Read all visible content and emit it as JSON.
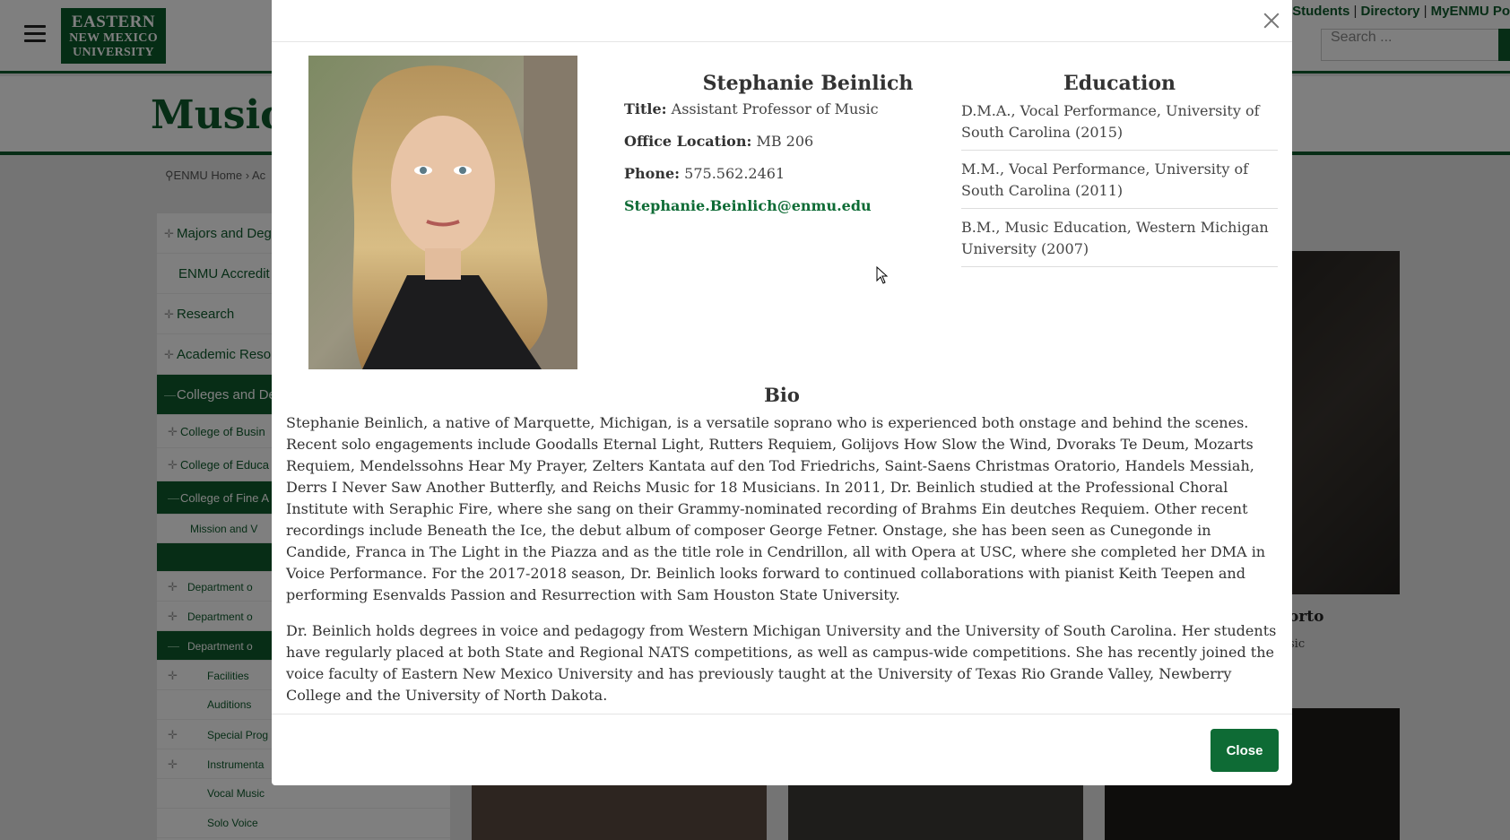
{
  "header": {
    "logo_lines": [
      "EASTERN",
      "NEW MEXICO",
      "UNIVERSITY"
    ],
    "top_links": [
      "t Students",
      "Directory",
      "MyENMU Po"
    ],
    "search_placeholder": "Search ..."
  },
  "page": {
    "title": "Music",
    "breadcrumb": [
      "ENMU Home",
      "Ac"
    ]
  },
  "sidebar": {
    "items": [
      {
        "label": "Majors and Degr",
        "expandable": true,
        "level": 1
      },
      {
        "label": "ENMU Accredit",
        "expandable": false,
        "level": 1
      },
      {
        "label": "Research",
        "expandable": true,
        "level": 1
      },
      {
        "label": "Academic Resou",
        "expandable": true,
        "level": 1
      },
      {
        "label": "Colleges and De",
        "expandable": true,
        "level": 1,
        "active": true
      },
      {
        "label": "College of Busin",
        "expandable": true,
        "level": 2
      },
      {
        "label": "College of Educa",
        "expandable": true,
        "level": 2
      },
      {
        "label": "College of Fine A",
        "expandable": true,
        "level": 2,
        "active": true
      },
      {
        "label": "Mission and V",
        "expandable": false,
        "level": 3
      },
      {
        "label": "",
        "expandable": false,
        "level": 3,
        "active": true
      },
      {
        "label": "Department o",
        "expandable": true,
        "level": 4
      },
      {
        "label": "Department o",
        "expandable": true,
        "level": 4
      },
      {
        "label": "Department o",
        "expandable": true,
        "level": 4,
        "active": true
      },
      {
        "label": "Facilities",
        "expandable": true,
        "level": 5
      },
      {
        "label": "Auditions",
        "expandable": false,
        "level": 5
      },
      {
        "label": "Special Prog",
        "expandable": true,
        "level": 5
      },
      {
        "label": "Instrumenta",
        "expandable": true,
        "level": 5
      },
      {
        "label": "Vocal Music",
        "expandable": false,
        "level": 5
      },
      {
        "label": "Solo Voice",
        "expandable": false,
        "level": 5
      }
    ]
  },
  "background_card": {
    "name_fragment": "orto",
    "title_fragment": "sic"
  },
  "modal": {
    "name": "Stephanie Beinlich",
    "title_label": "Title:",
    "title_value": "Assistant Professor of Music",
    "office_label": "Office Location:",
    "office_value": "MB 206",
    "phone_label": "Phone:",
    "phone_value": "575.562.2461",
    "email": "Stephanie.Beinlich@enmu.edu",
    "education_heading": "Education",
    "education": [
      "D.M.A., Vocal Performance, University of South Carolina (2015)",
      "M.M., Vocal Performance, University of South Carolina (2011)",
      "B.M., Music Education, Western Michigan University (2007)"
    ],
    "bio_heading": "Bio",
    "bio_paragraphs": [
      "Stephanie Beinlich, a native of Marquette, Michigan, is a versatile soprano who is experienced both onstage and behind the scenes. Recent solo engagements include Goodalls Eternal Light, Rutters Requiem, Golijovs How Slow the Wind, Dvoraks Te Deum, Mozarts Requiem, Mendelssohns Hear My Prayer, Zelters Kantata auf den Tod Friedrichs, Saint-Saens Christmas Oratorio, Handels Messiah, Derrs I Never Saw Another Butterfly, and Reichs Music for 18 Musicians. In 2011, Dr. Beinlich studied at the Professional Choral Institute with Seraphic Fire, where she sang on their Grammy-nominated recording of Brahms Ein deutches Requiem. Other recent recordings include Beneath the Ice, the debut album of composer George Fetner. Onstage, she has been seen as Cunegonde in Candide, Franca in The Light in the Piazza and as the title role in Cendrillon, all with Opera at USC, where she completed her DMA in Voice Performance. For the 2017-2018 season, Dr. Beinlich looks forward to continued collaborations with pianist Keith Teepen and performing Esenvalds Passion and Resurrection with Sam Houston State University.",
      "Dr. Beinlich holds degrees in voice and pedagogy from Western Michigan University and the University of South Carolina. Her students have regularly placed at both State and Regional NATS competitions, as well as campus-wide competitions. She has recently joined the voice faculty of Eastern New Mexico University and has previously taught at the University of Texas Rio Grande Valley, Newberry College and the University of North Dakota."
    ],
    "close_label": "Close"
  },
  "colors": {
    "brand_green": "#0e5a2c",
    "button_green": "#0e6b35",
    "overlay": "rgba(0,0,0,0.5)"
  }
}
